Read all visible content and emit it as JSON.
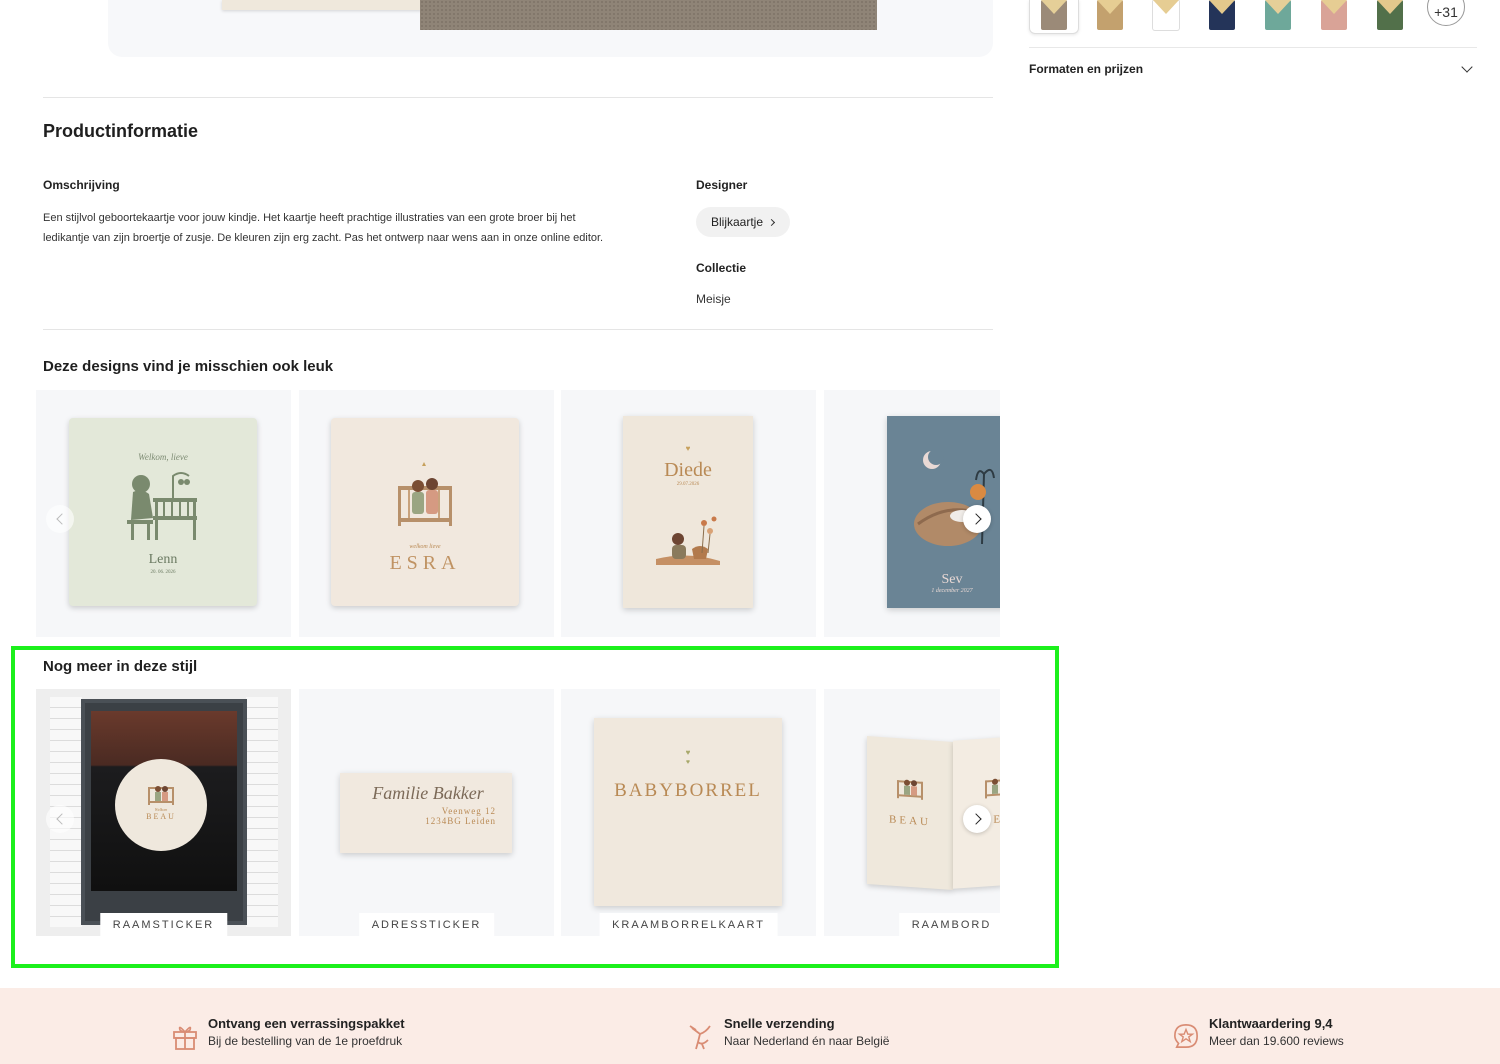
{
  "sidebar": {
    "swatches": [
      {
        "name": "taupe",
        "body": "#9b8a78",
        "flap": "#e5cf98"
      },
      {
        "name": "kraft",
        "body": "#c3a16e",
        "flap": "#e6cd93"
      },
      {
        "name": "white",
        "body": "#ffffff",
        "flap": "#e6cd93"
      },
      {
        "name": "navy",
        "body": "#243459",
        "flap": "#e3c88c"
      },
      {
        "name": "sage-teal",
        "body": "#6ea89a",
        "flap": "#e5cf98"
      },
      {
        "name": "blush",
        "body": "#d9a397",
        "flap": "#e6cd93"
      },
      {
        "name": "forest",
        "body": "#52704a",
        "flap": "#e3c88c"
      }
    ],
    "more_swatches": "+31",
    "formats_label": "Formaten en prijzen"
  },
  "product_info": {
    "heading": "Productinformatie",
    "description_label": "Omschrijving",
    "description_line1": "Een stijlvol geboortekaartje voor jouw kindje. Het kaartje heeft prachtige illustraties van een grote broer bij het",
    "description_line2": "ledikantje van zijn broertje of zusje. De kleuren zijn erg zacht. Pas het ontwerp naar wens aan in onze online editor.",
    "designer_label": "Designer",
    "designer_name": "Blijkaartje",
    "collection_label": "Collectie",
    "collection_value": "Meisje"
  },
  "related": {
    "heading": "Deze designs vind je misschien ook leuk",
    "cards": [
      {
        "script": "Welkom, lieve",
        "name": "Lenn",
        "date": "20. 06. 2026"
      },
      {
        "script": "welkom lieve",
        "name": "ESRA"
      },
      {
        "name": "Diede",
        "date": "29.07.2026"
      },
      {
        "name": "Sev",
        "date": "1 december 2027"
      }
    ]
  },
  "style_more": {
    "heading": "Nog meer in deze stijl",
    "items": [
      {
        "label": "RAAMSTICKER",
        "card_text": "BEAU",
        "card_script": "Welkom"
      },
      {
        "label": "ADRESSTICKER",
        "script": "Familie Bakker",
        "line1": "Veenweg 12",
        "line2": "1234BG Leiden"
      },
      {
        "label": "KRAAMBORRELKAART",
        "title": "BABYBORREL"
      },
      {
        "label": "RAAMBORD",
        "card_text": "BEAU",
        "card_text_2": "BE"
      }
    ]
  },
  "benefits": [
    {
      "icon": "gift-icon",
      "title": "Ontvang een verrassingspakket",
      "subtitle": "Bij de bestelling van de 1e proefdruk"
    },
    {
      "icon": "stork-icon",
      "title": "Snelle verzending",
      "subtitle": "Naar Nederland én naar België"
    },
    {
      "icon": "star-badge-icon",
      "title": "Klantwaardering 9,4",
      "subtitle": "Meer dan 19.600 reviews"
    }
  ],
  "colors": {
    "highlight": "#1cf01c",
    "footer_bg": "#fbece6",
    "accent_gold": "#b98a55",
    "icon_terracotta": "#d98c74"
  }
}
